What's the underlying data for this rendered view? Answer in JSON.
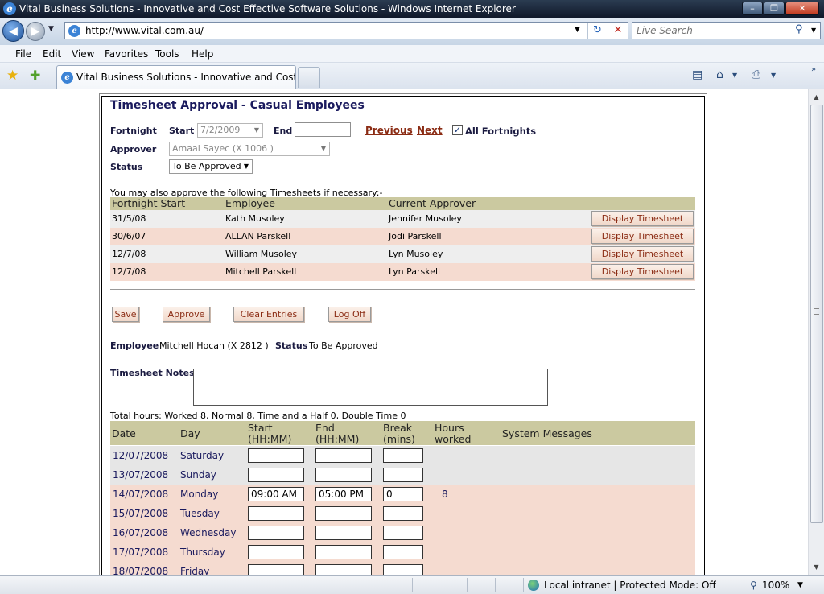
{
  "browser": {
    "window_title": "Vital Business Solutions - Innovative and Cost Effective Software Solutions - Windows Internet Explorer",
    "url": "http://www.vital.com.au/",
    "search_placeholder": "Live Search",
    "menu": [
      "File",
      "Edit",
      "View",
      "Favorites",
      "Tools",
      "Help"
    ],
    "tab_title": "Vital Business Solutions - Innovative and Cost Eff...",
    "status_zone": "Local intranet | Protected Mode: Off",
    "zoom": "100%"
  },
  "page": {
    "title": "Timesheet Approval - Casual Employees",
    "filters": {
      "fortnight_label": "Fortnight",
      "start_label": "Start",
      "start_value": "7/2/2009",
      "end_label": "End",
      "end_value": "",
      "previous_label": "Previous",
      "next_label": "Next",
      "all_fortnights_label": "All Fortnights",
      "all_fortnights_checked": true,
      "approver_label": "Approver",
      "approver_value": "Amaal Sayec   (X  1006    )",
      "status_label": "Status",
      "status_value": "To Be Approved"
    },
    "also_approve_note": "You may also approve the following Timesheets if necessary:-",
    "approvals": {
      "headers": [
        "Fortnight Start",
        "Employee",
        "Current Approver"
      ],
      "button_label": "Display Timesheet",
      "rows": [
        {
          "start": "31/5/08",
          "employee": "Kath Musoley",
          "approver": "Jennifer Musoley"
        },
        {
          "start": "30/6/07",
          "employee": "ALLAN Parskell",
          "approver": "Jodi Parskell"
        },
        {
          "start": "12/7/08",
          "employee": "William Musoley",
          "approver": "Lyn Musoley"
        },
        {
          "start": "12/7/08",
          "employee": "Mitchell Parskell",
          "approver": "Lyn Parskell"
        }
      ]
    },
    "actions": {
      "save": "Save",
      "approve": "Approve",
      "clear": "Clear Entries",
      "logoff": "Log Off"
    },
    "employee": {
      "employee_label": "Employee",
      "employee_value": "Mitchell Hocan (X  2812    )",
      "status_label": "Status",
      "status_value": "To Be Approved"
    },
    "notes_label": "Timesheet Notes",
    "notes_value": "",
    "total_hours": "Total hours: Worked 8, Normal 8, Time and a Half 0, Double Time 0",
    "timesheet": {
      "headers": {
        "date": "Date",
        "day": "Day",
        "start_1": "Start",
        "start_2": "(HH:MM)",
        "end_1": "End",
        "end_2": "(HH:MM)",
        "break_1": "Break",
        "break_2": "(mins)",
        "hours_1": "Hours",
        "hours_2": "worked",
        "messages": "System Messages"
      },
      "rows": [
        {
          "date": "12/07/2008",
          "day": "Saturday",
          "start": "",
          "end": "",
          "break": "",
          "hours": ""
        },
        {
          "date": "13/07/2008",
          "day": "Sunday",
          "start": "",
          "end": "",
          "break": "",
          "hours": ""
        },
        {
          "date": "14/07/2008",
          "day": "Monday",
          "start": "09:00 AM",
          "end": "05:00 PM",
          "break": "0",
          "hours": "8"
        },
        {
          "date": "15/07/2008",
          "day": "Tuesday",
          "start": "",
          "end": "",
          "break": "",
          "hours": ""
        },
        {
          "date": "16/07/2008",
          "day": "Wednesday",
          "start": "",
          "end": "",
          "break": "",
          "hours": ""
        },
        {
          "date": "17/07/2008",
          "day": "Thursday",
          "start": "",
          "end": "",
          "break": "",
          "hours": ""
        },
        {
          "date": "18/07/2008",
          "day": "Friday",
          "start": "",
          "end": "",
          "break": "",
          "hours": ""
        }
      ]
    }
  }
}
